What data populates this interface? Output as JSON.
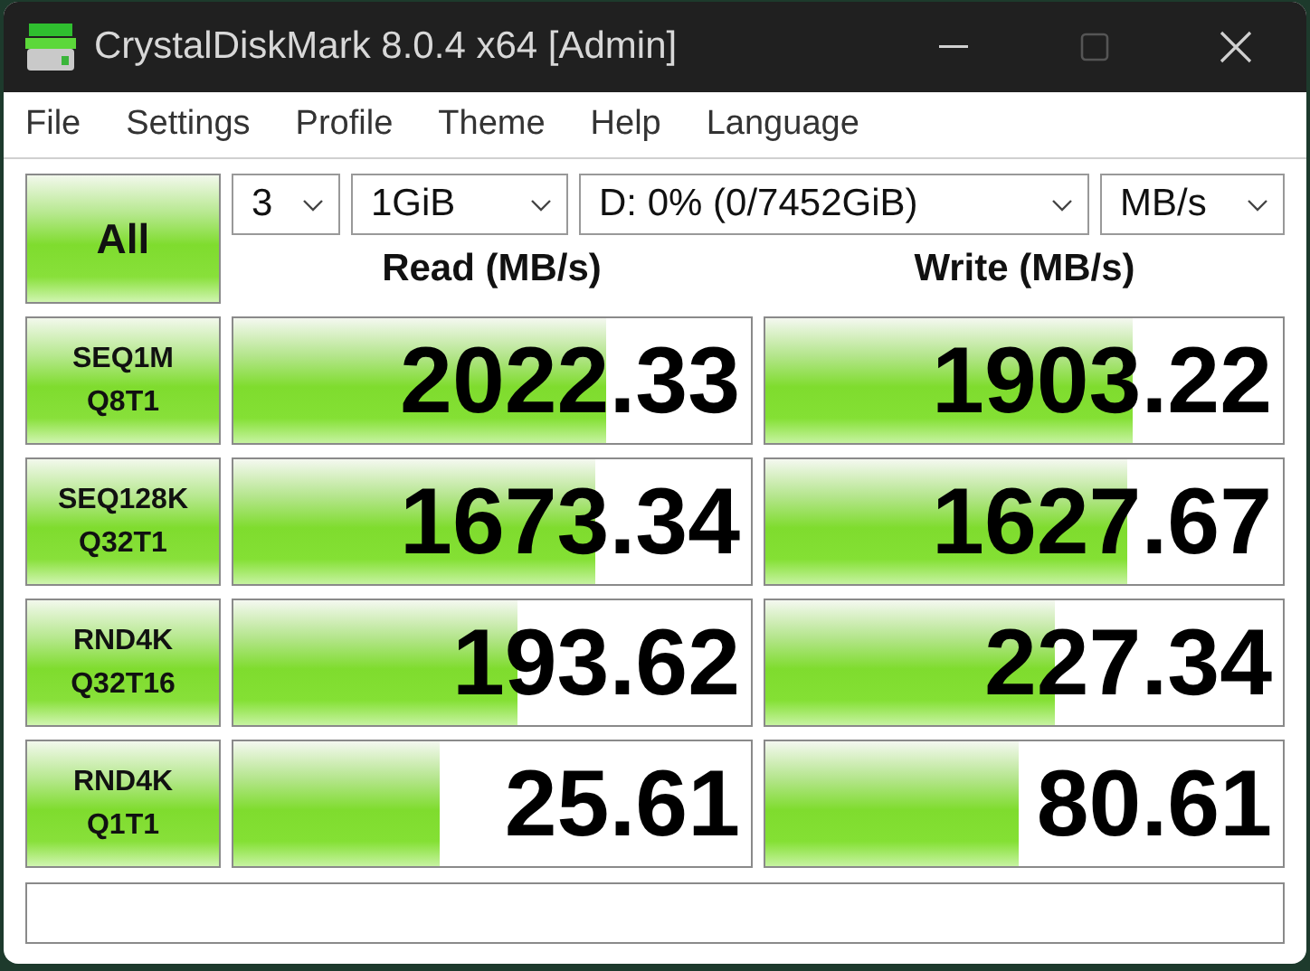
{
  "window": {
    "title": "CrystalDiskMark 8.0.4 x64 [Admin]",
    "controls": [
      {
        "kind": "minimize",
        "disabled": false
      },
      {
        "kind": "maximize",
        "disabled": true
      },
      {
        "kind": "close",
        "disabled": false
      }
    ]
  },
  "menu": [
    "File",
    "Settings",
    "Profile",
    "Theme",
    "Help",
    "Language"
  ],
  "all_button": "All",
  "selectors": [
    {
      "value": "3"
    },
    {
      "value": "1GiB"
    },
    {
      "value": "D: 0% (0/7452GiB)"
    },
    {
      "value": "MB/s"
    }
  ],
  "columns": [
    "Read (MB/s)",
    "Write (MB/s)"
  ],
  "rows": [
    {
      "test": "SEQ1M",
      "params": "Q8T1",
      "read": {
        "value": "2022.33",
        "level": 0.72
      },
      "write": {
        "value": "1903.22",
        "level": 0.71
      }
    },
    {
      "test": "SEQ128K",
      "params": "Q32T1",
      "read": {
        "value": "1673.34",
        "level": 0.7
      },
      "write": {
        "value": "1627.67",
        "level": 0.7
      }
    },
    {
      "test": "RND4K",
      "params": "Q32T16",
      "read": {
        "value": "193.62",
        "level": 0.55
      },
      "write": {
        "value": "227.34",
        "level": 0.56
      }
    },
    {
      "test": "RND4K",
      "params": "Q1T1",
      "read": {
        "value": "25.61",
        "level": 0.4
      },
      "write": {
        "value": "80.61",
        "level": 0.49
      }
    }
  ]
}
